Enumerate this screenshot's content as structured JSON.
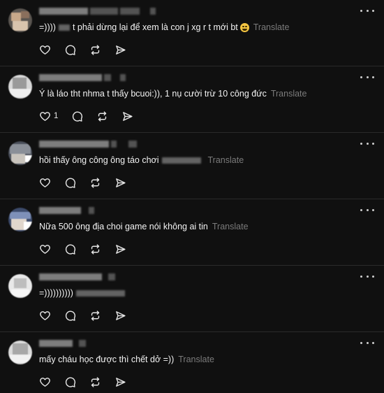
{
  "translate_label": "Translate",
  "comments": [
    {
      "text": "=)))) ",
      "text_after": " t phải dừng lại để xem là con j xg r t mới bt",
      "emoji": "crying-laughing-emoji",
      "like_count": ""
    },
    {
      "text": "Ý là láo tht nhma t thấy bcuoi:)), 1 nụ cười trừ 10 công đức",
      "like_count": "1"
    },
    {
      "text": "hồi thấy ông công ông táo chơi ",
      "like_count": ""
    },
    {
      "text": "Nữa 500 ông địa choi game nói không ai tin",
      "like_count": ""
    },
    {
      "text": "=))))))))))",
      "like_count": ""
    },
    {
      "text": "mấy cháu học được thì chết dở =))",
      "like_count": ""
    }
  ],
  "icons": {
    "like": "heart-icon",
    "reply": "comment-bubble-icon",
    "repost": "repost-icon",
    "share": "send-icon",
    "more": "more-dots-icon"
  }
}
